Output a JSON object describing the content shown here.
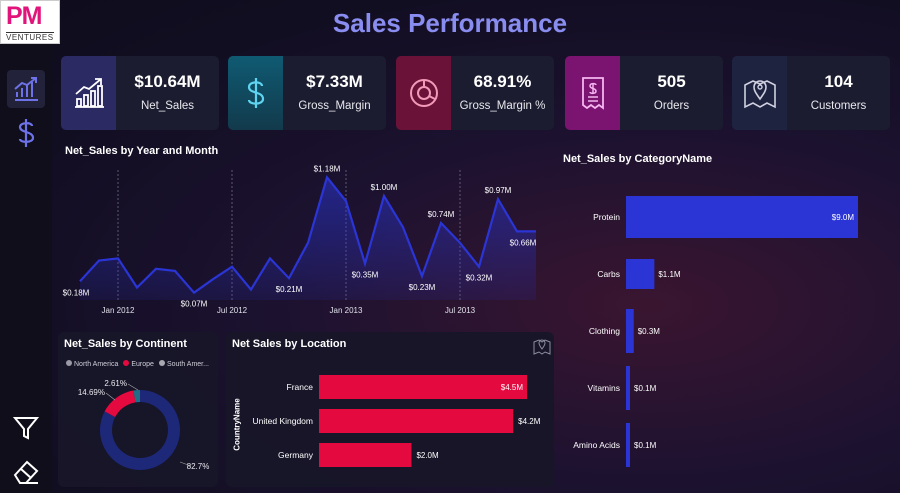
{
  "logo": {
    "main": "PM",
    "sub": "VENTURES"
  },
  "header": {
    "title": "Sales Performance"
  },
  "sidebar": {
    "icons": [
      "sales-chart-icon",
      "dollar-icon",
      "filter-icon",
      "eraser-icon"
    ]
  },
  "kpis": [
    {
      "value": "$10.64M",
      "label": "Net_Sales",
      "icon": "growth-chart-icon",
      "color": "#2b2a63"
    },
    {
      "value": "$7.33M",
      "label": "Gross_Margin",
      "icon": "dollar-icon",
      "color": "#0f5a72"
    },
    {
      "value": "68.91%",
      "label": "Gross_Margin %",
      "icon": "donut-icon",
      "color": "#6a1238"
    },
    {
      "value": "505",
      "label": "Orders",
      "icon": "receipt-icon",
      "color": "#7a1470"
    },
    {
      "value": "104",
      "label": "Customers",
      "icon": "map-pin-icon",
      "color": "#1e2340"
    }
  ],
  "colors": {
    "blue": "#2b35d6",
    "pink": "#e4093f",
    "title": "#8a8df0",
    "green": "#1f6d86"
  },
  "chart_data": [
    {
      "type": "area",
      "title": "Net_Sales by Year and Month",
      "x_ticks": [
        "Jan 2012",
        "Jul 2012",
        "Jan 2013",
        "Jul 2013"
      ],
      "x": [
        "2011-11",
        "2011-12",
        "2012-01",
        "2012-02",
        "2012-03",
        "2012-04",
        "2012-05",
        "2012-06",
        "2012-07",
        "2012-08",
        "2012-09",
        "2012-10",
        "2012-11",
        "2012-12",
        "2013-01",
        "2013-02",
        "2013-03",
        "2013-04",
        "2013-05",
        "2013-06",
        "2013-07",
        "2013-08",
        "2013-09",
        "2013-10",
        "2013-11"
      ],
      "values": [
        0.18,
        0.38,
        0.4,
        0.12,
        0.3,
        0.28,
        0.07,
        0.2,
        0.32,
        0.1,
        0.4,
        0.21,
        0.55,
        1.18,
        0.95,
        0.35,
        1.0,
        0.7,
        0.23,
        0.74,
        0.55,
        0.32,
        0.97,
        0.66,
        0.66
      ],
      "labels": [
        {
          "i": 0,
          "text": "$0.18M",
          "pos": "below"
        },
        {
          "i": 6,
          "text": "$0.07M",
          "pos": "below"
        },
        {
          "i": 11,
          "text": "$0.21M",
          "pos": "below"
        },
        {
          "i": 13,
          "text": "$1.18M",
          "pos": "above"
        },
        {
          "i": 15,
          "text": "$0.35M",
          "pos": "below"
        },
        {
          "i": 16,
          "text": "$1.00M",
          "pos": "above"
        },
        {
          "i": 18,
          "text": "$0.23M",
          "pos": "below"
        },
        {
          "i": 19,
          "text": "$0.74M",
          "pos": "above"
        },
        {
          "i": 21,
          "text": "$0.32M",
          "pos": "below"
        },
        {
          "i": 22,
          "text": "$0.97M",
          "pos": "above"
        },
        {
          "i": 23,
          "text": "$0.66M",
          "pos": "below"
        }
      ],
      "ylim": [
        0,
        1.25
      ],
      "color": "#2b35d6"
    },
    {
      "type": "bar",
      "title": "Net_Sales by CategoryName",
      "orientation": "horizontal",
      "categories": [
        "Protein",
        "Carbs",
        "Clothing",
        "Vitamins",
        "Amino Acids"
      ],
      "values": [
        9.0,
        1.1,
        0.3,
        0.1,
        0.1
      ],
      "value_labels": [
        "$9.0M",
        "$1.1M",
        "$0.3M",
        "$0.1M",
        "$0.1M"
      ],
      "xlim": [
        0,
        9.0
      ],
      "color": "#2b35d6"
    },
    {
      "type": "pie",
      "title": "Net_Sales by Continent",
      "legend": [
        "North America",
        "Europe",
        "South Amer..."
      ],
      "legend_colors": [
        "#9a9aa6",
        "#e4093f",
        "#a8a8b0"
      ],
      "slices": [
        {
          "name": "North America",
          "value": 82.7,
          "label": "82.7%",
          "color": "#1d2878"
        },
        {
          "name": "Europe",
          "value": 14.69,
          "label": "14.69%",
          "color": "#e4093f"
        },
        {
          "name": "South America",
          "value": 2.61,
          "label": "2.61%",
          "color": "#1f6d86"
        }
      ]
    },
    {
      "type": "bar",
      "title": "Net Sales by Location",
      "orientation": "horizontal",
      "ylabel": "CountryName",
      "categories": [
        "France",
        "United Kingdom",
        "Germany"
      ],
      "values": [
        4.5,
        4.2,
        2.0
      ],
      "value_labels": [
        "$4.5M",
        "$4.2M",
        "$2.0M"
      ],
      "xlim": [
        0,
        4.5
      ],
      "color": "#e4093f"
    }
  ]
}
